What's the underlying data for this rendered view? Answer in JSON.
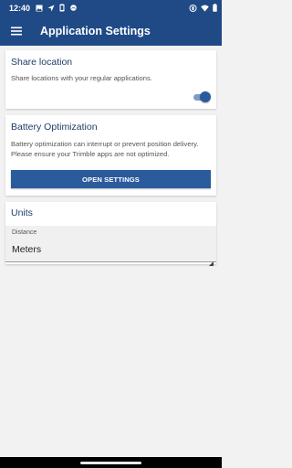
{
  "status_bar": {
    "time": "12:40",
    "left_icons": [
      "image-icon",
      "navigation-icon",
      "sim-icon",
      "cloud-icon"
    ],
    "right_icons": [
      "vibrate-icon",
      "wifi-icon",
      "battery-icon"
    ]
  },
  "app_bar": {
    "title": "Application Settings",
    "menu_icon": "hamburger-menu-icon"
  },
  "share_location": {
    "title": "Share location",
    "description": "Share locations with your regular applications.",
    "enabled": true
  },
  "battery": {
    "title": "Battery Optimization",
    "description": "Battery optimization can interrupt or prevent position delivery. Please ensure your Trimble apps are not optimized.",
    "button_label": "OPEN SETTINGS"
  },
  "units": {
    "title": "Units",
    "field_label": "Distance",
    "selected": "Meters"
  },
  "colors": {
    "primary": "#1f4a86",
    "accent": "#2a5b9c",
    "title_text": "#1f3d66",
    "background": "#f2f2f2"
  }
}
